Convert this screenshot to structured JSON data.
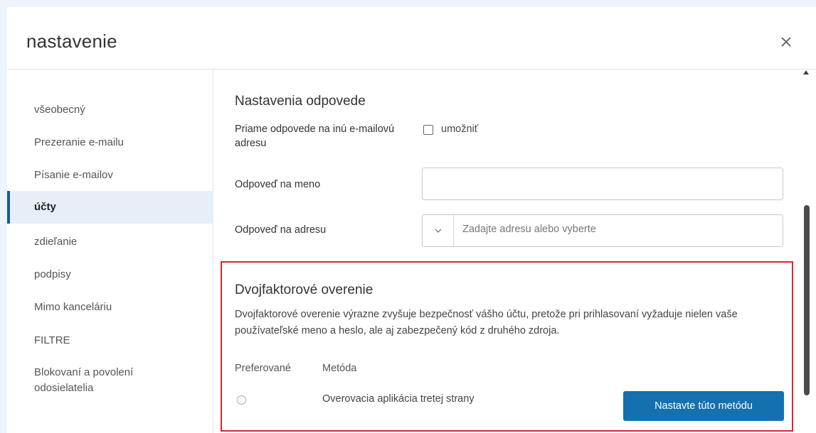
{
  "dialog": {
    "title": "nastavenie",
    "close_icon": "close-icon"
  },
  "sidebar": {
    "items": [
      {
        "label": "všeobecný"
      },
      {
        "label": "Prezeranie e-mailu"
      },
      {
        "label": "Písanie e-mailov"
      },
      {
        "label": "účty",
        "active": true
      },
      {
        "label": "zdieľanie"
      },
      {
        "label": "podpisy"
      },
      {
        "label": "Mimo kanceláriu"
      },
      {
        "label": "FILTRE"
      },
      {
        "label": "Blokovaní a povolení odosielatelia"
      }
    ]
  },
  "reply": {
    "title": "Nastavenia odpovede",
    "direct_label": "Priame odpovede na inú e-mailovú adresu",
    "enable_label": "umožniť",
    "enable_checked": false,
    "reply_name_label": "Odpoveď na meno",
    "reply_name_value": "",
    "reply_address_label": "Odpoveď na adresu",
    "reply_address_placeholder": "Zadajte adresu alebo vyberte"
  },
  "two_factor": {
    "title": "Dvojfaktorové overenie",
    "description": "Dvojfaktorové overenie výrazne zvyšuje bezpečnosť vášho účtu, pretože pri prihlasovaní vyžaduje nielen vaše používateľské meno a heslo, ale aj zabezpečený kód z druhého zdroja.",
    "col_preferred": "Preferované",
    "col_method": "Metóda",
    "methods": [
      {
        "name": "Overovacia aplikácia tretej strany",
        "selected": false,
        "button": "Nastavte túto metódu"
      }
    ]
  },
  "colors": {
    "accent": "#1570b0",
    "active_nav_bg": "#e6eef7",
    "active_nav_bar": "#1a5a96",
    "highlight_border": "#d9262b"
  }
}
